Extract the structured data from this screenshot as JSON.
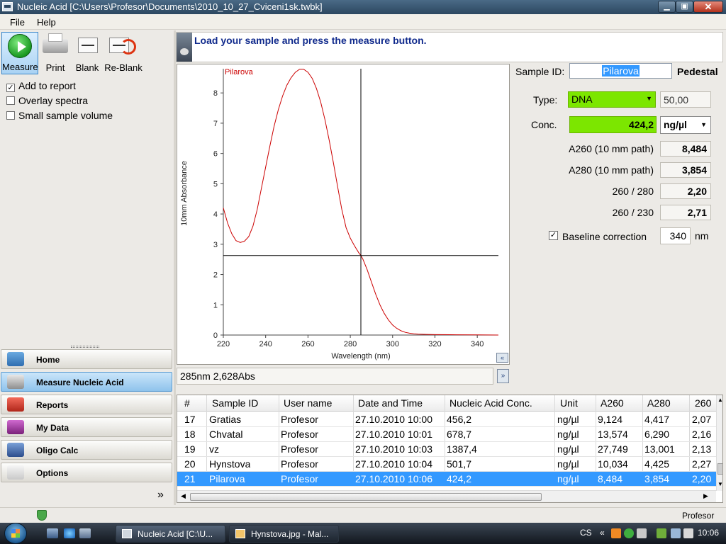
{
  "window": {
    "title": "Nucleic Acid  [C:\\Users\\Profesor\\Documents\\2010_10_27_Cviceni1sk.twbk]",
    "min_glyph": "▁",
    "max_glyph": "▣",
    "close_glyph": "✕"
  },
  "menu": {
    "file": "File",
    "help": "Help"
  },
  "toolbar": {
    "measure": "Measure",
    "print": "Print",
    "blank": "Blank",
    "reblank": "Re-Blank"
  },
  "options": [
    {
      "label": "Add to report",
      "checked": true,
      "mark": "✓"
    },
    {
      "label": "Overlay spectra",
      "checked": false,
      "mark": ""
    },
    {
      "label": "Small sample volume",
      "checked": false,
      "mark": ""
    }
  ],
  "nav": [
    {
      "label": "Home",
      "active": false
    },
    {
      "label": "Measure Nucleic Acid",
      "active": true
    },
    {
      "label": "Reports",
      "active": false
    },
    {
      "label": "My Data",
      "active": false
    },
    {
      "label": "Oligo Calc",
      "active": false
    },
    {
      "label": "Options",
      "active": false
    }
  ],
  "nav_more": "»",
  "prompt": "Load your sample and press the measure button.",
  "chart_data": {
    "type": "line",
    "series": [
      {
        "name": "Pilarova",
        "color": "#cc0000",
        "points": [
          [
            220,
            4.2
          ],
          [
            222,
            3.7
          ],
          [
            224,
            3.35
          ],
          [
            226,
            3.12
          ],
          [
            228,
            3.06
          ],
          [
            230,
            3.1
          ],
          [
            232,
            3.25
          ],
          [
            234,
            3.6
          ],
          [
            236,
            4.15
          ],
          [
            238,
            4.85
          ],
          [
            240,
            5.55
          ],
          [
            242,
            6.25
          ],
          [
            244,
            6.9
          ],
          [
            246,
            7.45
          ],
          [
            248,
            7.9
          ],
          [
            250,
            8.25
          ],
          [
            252,
            8.5
          ],
          [
            254,
            8.68
          ],
          [
            256,
            8.78
          ],
          [
            258,
            8.78
          ],
          [
            260,
            8.68
          ],
          [
            262,
            8.48
          ],
          [
            264,
            8.15
          ],
          [
            266,
            7.7
          ],
          [
            268,
            7.12
          ],
          [
            270,
            6.45
          ],
          [
            272,
            5.7
          ],
          [
            274,
            4.9
          ],
          [
            276,
            4.15
          ],
          [
            278,
            3.55
          ],
          [
            280,
            3.2
          ],
          [
            282,
            2.95
          ],
          [
            284,
            2.72
          ],
          [
            285,
            2.628
          ],
          [
            286,
            2.5
          ],
          [
            288,
            2.15
          ],
          [
            290,
            1.75
          ],
          [
            292,
            1.35
          ],
          [
            294,
            1.0
          ],
          [
            296,
            0.72
          ],
          [
            298,
            0.5
          ],
          [
            300,
            0.33
          ],
          [
            302,
            0.22
          ],
          [
            304,
            0.14
          ],
          [
            306,
            0.09
          ],
          [
            308,
            0.06
          ],
          [
            310,
            0.04
          ],
          [
            312,
            0.03
          ],
          [
            316,
            0.02
          ],
          [
            320,
            0.015
          ],
          [
            330,
            0.01
          ],
          [
            340,
            0.005
          ],
          [
            350,
            0.0
          ]
        ]
      }
    ],
    "xlabel": "Wavelength (nm)",
    "ylabel": "10mm Absorbance",
    "xlim": [
      220,
      350
    ],
    "ylim": [
      0,
      8.8
    ],
    "xticks": [
      220,
      240,
      260,
      280,
      300,
      320,
      340
    ],
    "yticks": [
      0,
      1,
      2,
      3,
      4,
      5,
      6,
      7,
      8
    ],
    "cursor": {
      "x": 285,
      "y": 2.628
    },
    "grid": false
  },
  "chart_collapse_glyph": "«",
  "readout": "285nm 2,628Abs",
  "readout_btn_glyph": "»",
  "sample": {
    "id_label": "Sample ID:",
    "id_value": "Pilarova",
    "mode": "Pedestal",
    "type_label": "Type:",
    "type_value": "DNA",
    "type_factor": "50,00",
    "conc_label": "Conc.",
    "conc_value": "424,2",
    "unit": "ng/µl",
    "metrics": [
      {
        "label": "A260 (10 mm path)",
        "value": "8,484"
      },
      {
        "label": "A280 (10 mm path)",
        "value": "3,854"
      },
      {
        "label": "260 / 280",
        "value": "2,20"
      },
      {
        "label": "260 / 230",
        "value": "2,71"
      }
    ],
    "baseline_label": "Baseline correction",
    "baseline_checked": true,
    "baseline_value": "340",
    "baseline_unit": "nm"
  },
  "table": {
    "columns": [
      "#",
      "Sample ID",
      "User name",
      "Date and Time",
      "Nucleic Acid Conc.",
      "Unit",
      "A260",
      "A280",
      "260"
    ],
    "rows": [
      [
        "17",
        "Gratias",
        "Profesor",
        "27.10.2010 10:00",
        "456,2",
        "ng/µl",
        "9,124",
        "4,417",
        "2,07"
      ],
      [
        "18",
        "Chvatal",
        "Profesor",
        "27.10.2010 10:01",
        "678,7",
        "ng/µl",
        "13,574",
        "6,290",
        "2,16"
      ],
      [
        "19",
        "vz",
        "Profesor",
        "27.10.2010 10:03",
        "1387,4",
        "ng/µl",
        "27,749",
        "13,001",
        "2,13"
      ],
      [
        "20",
        "Hynstova",
        "Profesor",
        "27.10.2010 10:04",
        "501,7",
        "ng/µl",
        "10,034",
        "4,425",
        "2,27"
      ],
      [
        "21",
        "Pilarova",
        "Profesor",
        "27.10.2010 10:06",
        "424,2",
        "ng/µl",
        "8,484",
        "3,854",
        "2,20"
      ]
    ],
    "selected_row": 4
  },
  "status": {
    "user": "Profesor"
  },
  "taskbar": {
    "tasks": [
      "Nucleic Acid  [C:\\U...",
      "Hynstova.jpg - Mal..."
    ],
    "lang": "CS",
    "chevron": "«",
    "clock": "10:06"
  }
}
